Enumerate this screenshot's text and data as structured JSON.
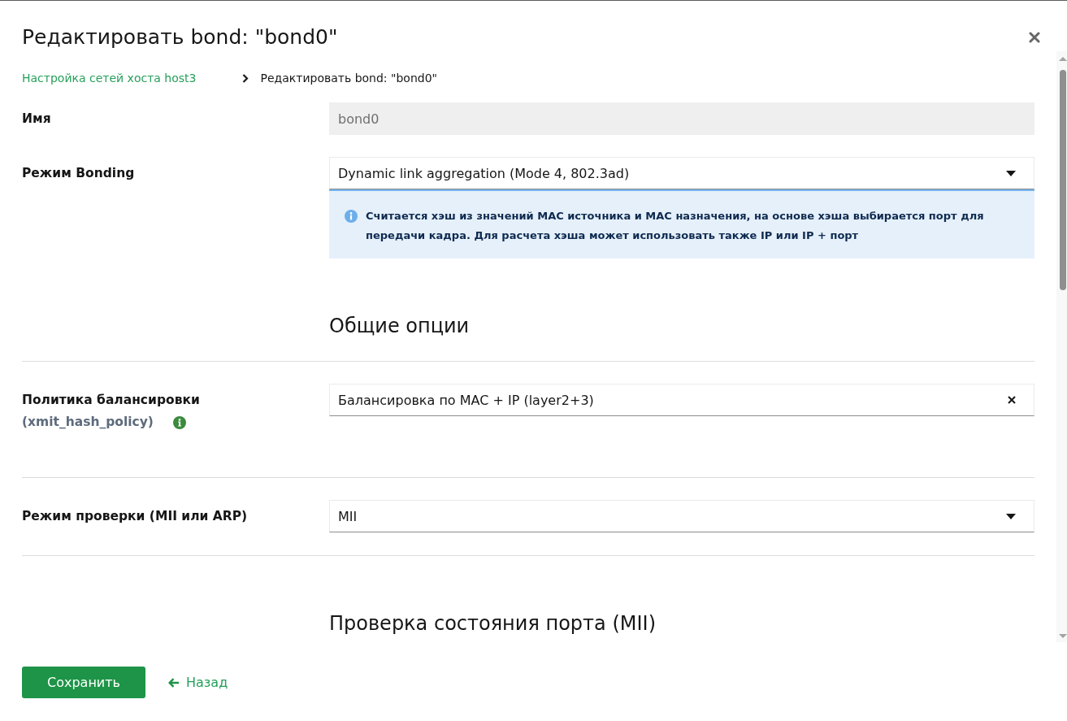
{
  "dialog": {
    "title": "Редактировать bond: \"bond0\""
  },
  "breadcrumb": [
    {
      "label": "Настройка сетей хоста host3",
      "kind": "link"
    },
    {
      "label": "Редактировать bond: \"bond0\"",
      "kind": "current"
    }
  ],
  "sections": [
    {
      "rows": [
        {
          "kind": "input",
          "label": "Имя",
          "value": "bond0",
          "disabled": true,
          "info": false
        },
        {
          "kind": "select",
          "label": "Режим Bonding",
          "value": "Dynamic link aggregation (Mode 4, 802.3ad)",
          "disabled": false,
          "clearable": false,
          "info": false,
          "hint": "Считается хэш из значений MAC источника и MAC назначения, на основе хэша выбирается порт для передачи кадра. Для расчета хэша может использовать также IP или IP + порт"
        }
      ]
    },
    {
      "heading": "Общие опции",
      "rows": [
        {
          "kind": "select",
          "label": "Политика балансировки",
          "sublabel": "(xmit_hash_policy)",
          "info": true,
          "value": "Балансировка по MAC + IP (layer2+3)",
          "disabled": false,
          "clearable": true
        },
        {
          "kind": "select",
          "label": "Режим проверки (MII или ARP)",
          "value": "MII",
          "disabled": false,
          "clearable": false,
          "info": false
        }
      ]
    },
    {
      "heading": "Проверка состояния порта (MII)"
    }
  ],
  "footer": {
    "save_button": "Сохранить",
    "back_link": "Назад"
  }
}
